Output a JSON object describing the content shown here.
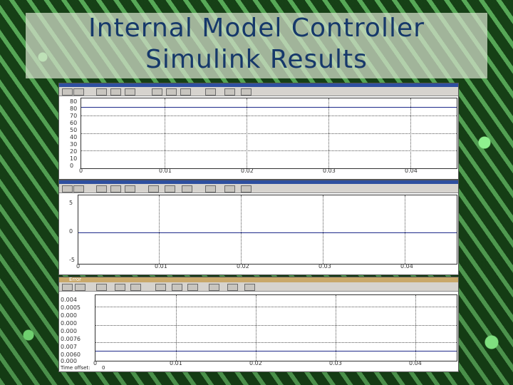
{
  "slide": {
    "title_line1": "Internal Model Controller",
    "title_line2": "Simulink Results"
  },
  "scope1": {
    "y_ticks": [
      "80",
      "80",
      "70",
      "60",
      "50",
      "40",
      "30",
      "20",
      "10",
      "0"
    ],
    "x_ticks": [
      "0",
      "0.01",
      "0.02",
      "0.03",
      "0.04"
    ]
  },
  "scope2": {
    "y_ticks": [
      "5",
      "0",
      "-5"
    ],
    "x_ticks": [
      "0",
      "0.01",
      "0.02",
      "0.03",
      "0.04"
    ]
  },
  "scope3": {
    "window_title": "Error",
    "y_ticks": [
      "0.004",
      "0.0005",
      "0.000",
      "0.000",
      "0.000",
      "0.0076",
      "0.007",
      "0.0060",
      "0.000"
    ],
    "x_ticks": [
      "0",
      "0.01",
      "0.02",
      "0.03",
      "0.04"
    ],
    "time_offset_label": "Time offset:",
    "time_offset_value": "0"
  }
}
